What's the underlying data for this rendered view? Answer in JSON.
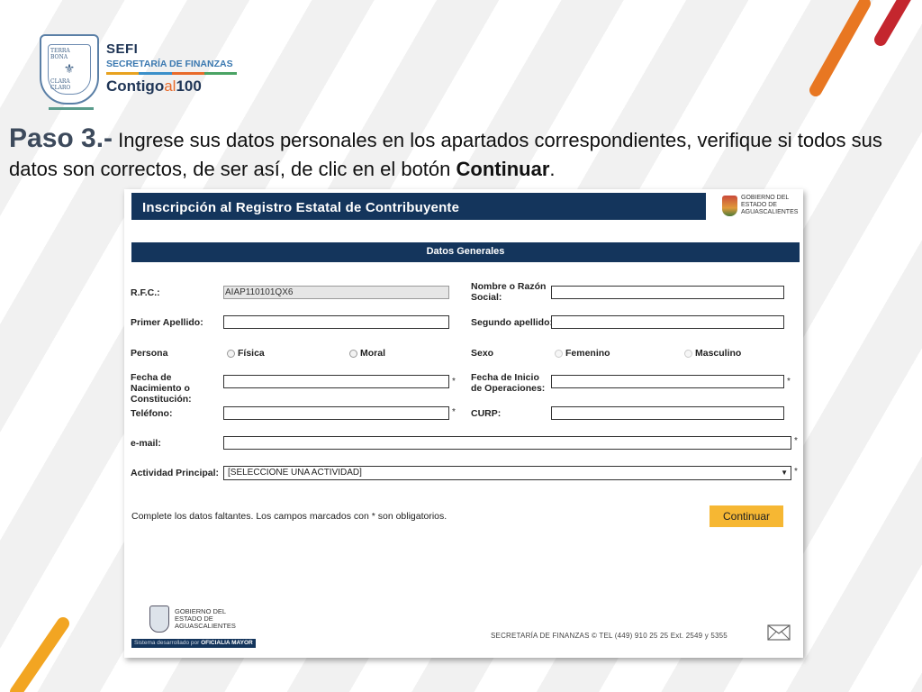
{
  "slide": {
    "step": "Paso 3.-",
    "instruction_1": " Ingrese sus datos personales en los apartados correspondientes, verifique si todos sus datos son correctos, de ser así, de clic en el botón ",
    "instruction_bold": "Continuar",
    "instruction_end": "."
  },
  "logo": {
    "crest_top": "TERRA BONA",
    "crest_bottom": "CLARA CLARO",
    "sefi": "SEFI",
    "secretaria": "SECRETARÍA DE FINANZAS",
    "contigo": "Contigo",
    "al": "al",
    "cien": "100",
    "bar_colors": [
      "#e8a21f",
      "#3a8fc9",
      "#e86a2a",
      "#4aa364"
    ]
  },
  "form": {
    "title": "Inscripción al Registro Estatal de Contribuyente",
    "gov_logo_text": "GOBIERNO DEL ESTADO DE AGUASCALIENTES",
    "section": "Datos Generales",
    "labels": {
      "rfc": "R.F.C.:",
      "nombre": "Nombre o Razón Social:",
      "primer_apellido": "Primer Apellido:",
      "segundo_apellido": "Segundo apellido:",
      "persona": "Persona",
      "sexo": "Sexo",
      "fecha_nac": "Fecha de Nacimiento o Constitución:",
      "fecha_inicio": "Fecha de Inicio de Operaciones:",
      "telefono": "Teléfono:",
      "curp": "CURP:",
      "email": "e-mail:",
      "actividad": "Actividad Principal:"
    },
    "values": {
      "rfc": "AIAP110101QX6",
      "nombre": "",
      "primer_apellido": "",
      "segundo_apellido": "",
      "fecha_nac": "",
      "fecha_inicio": "",
      "telefono": "",
      "curp": "",
      "email": ""
    },
    "persona_options": [
      "Física",
      "Moral"
    ],
    "sexo_options": [
      "Femenino",
      "Masculino"
    ],
    "actividad_selected": "[SELECCIONE UNA ACTIVIDAD]",
    "required_mark": "*",
    "note": "Complete los datos faltantes. Los campos marcados con * son obligatorios.",
    "continue_label": "Continuar",
    "footer_gov": "GOBIERNO DEL ESTADO DE AGUASCALIENTES",
    "dev_prefix": "Sistema desarrollado por ",
    "dev_name": "OFICIALIA MAYOR",
    "footer_text": "SECRETARÍA DE FINANZAS ©    TEL (449) 910 25 25   Ext. 2549 y 5355",
    "colors": {
      "header": "#14355c",
      "button": "#f6b733"
    }
  }
}
